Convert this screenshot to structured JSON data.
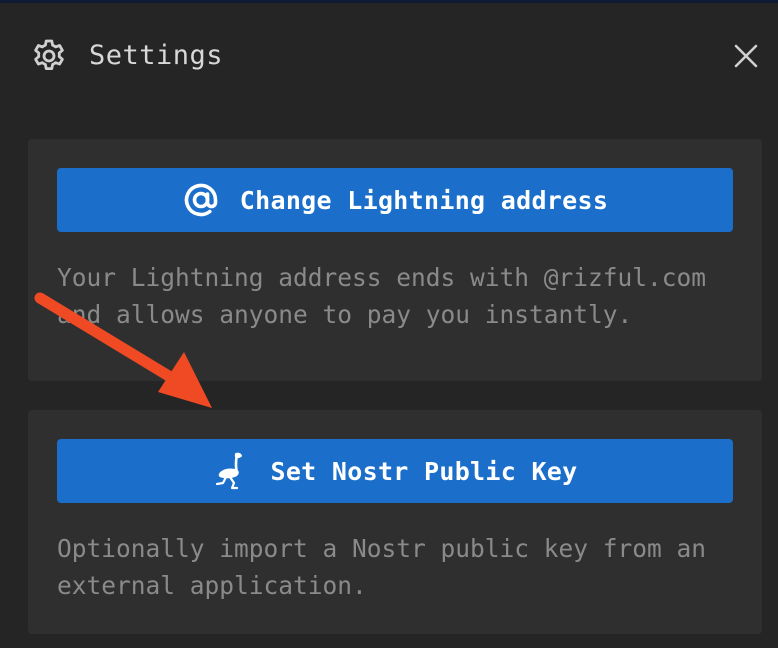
{
  "header": {
    "title": "Settings",
    "icon": "gear-icon",
    "close_icon": "close-icon"
  },
  "cards": [
    {
      "button_label": "Change Lightning address",
      "button_icon": "at-sign-icon",
      "description": "Your Lightning address ends with @rizful.com and allows anyone to pay you instantly."
    },
    {
      "button_label": "Set Nostr Public Key",
      "button_icon": "ostrich-icon",
      "description": "Optionally import a Nostr public key from an external application."
    }
  ],
  "annotation": {
    "icon": "arrow-annotation",
    "color": "#ef4a23"
  },
  "colors": {
    "background": "#252525",
    "card": "#2f2f2f",
    "button": "#1b6fca",
    "text_primary": "#ffffff",
    "text_muted": "#8a8a8a"
  }
}
